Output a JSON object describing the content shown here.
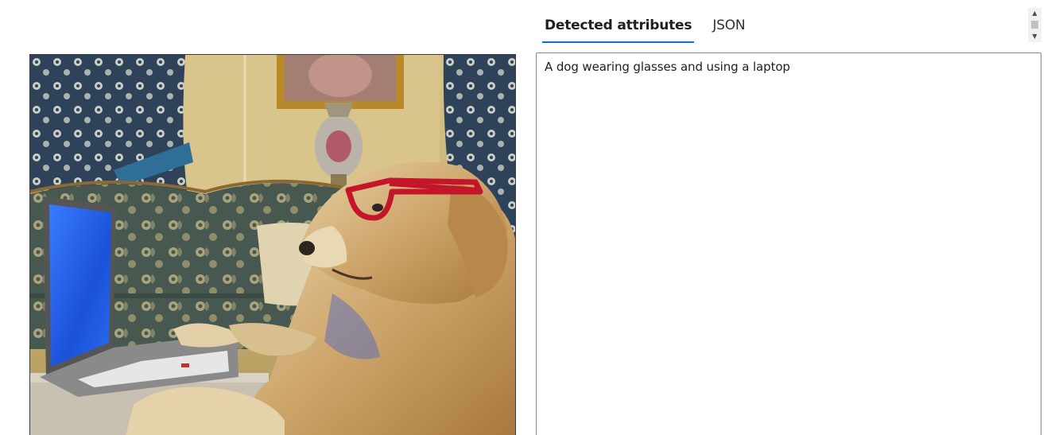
{
  "tabs": [
    {
      "label": "Detected attributes",
      "active": true
    },
    {
      "label": "JSON",
      "active": false
    }
  ],
  "result": {
    "caption": "A dog wearing glasses and using a laptop"
  },
  "photo": {
    "subject": "dog wearing red glasses at a laptop"
  },
  "colors": {
    "accent": "#0078d4",
    "border": "#8a8886"
  }
}
